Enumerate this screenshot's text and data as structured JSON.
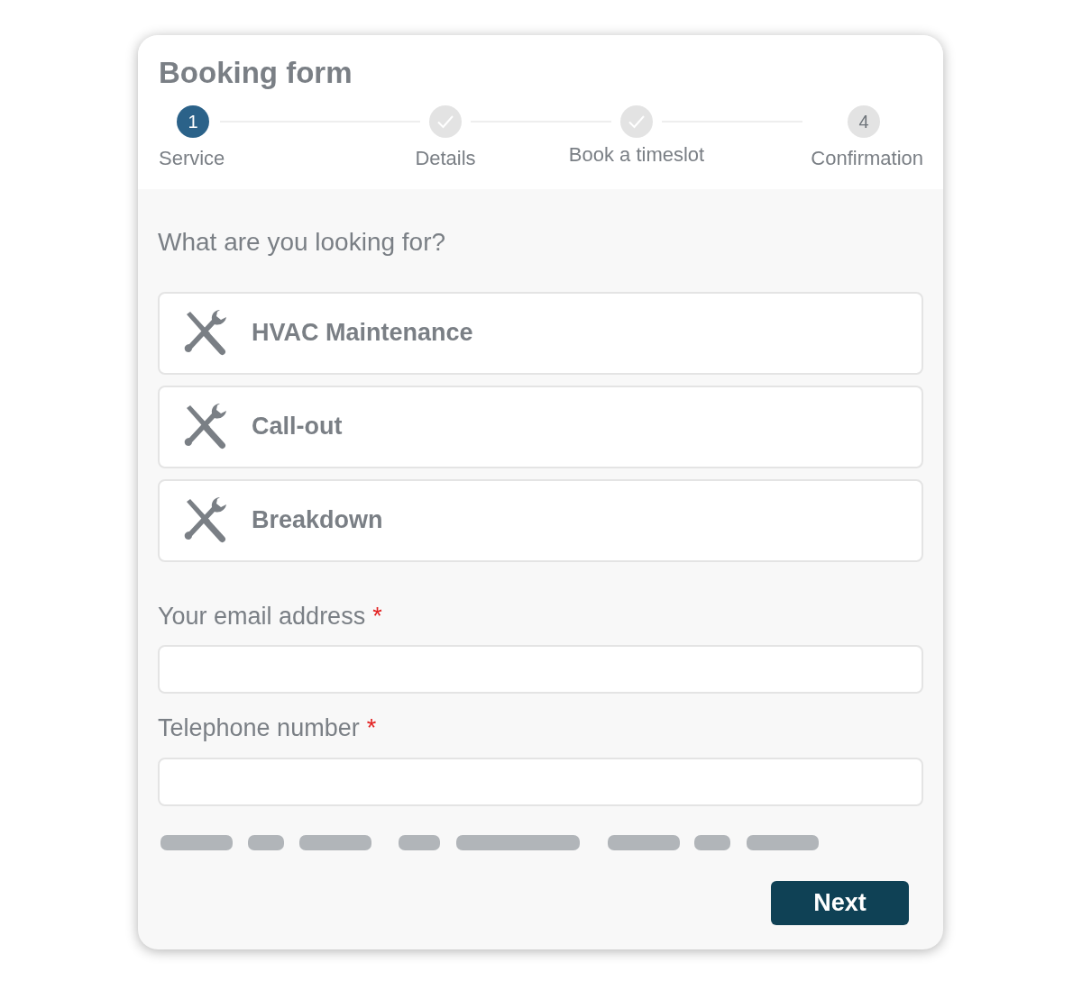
{
  "title": "Booking form",
  "steps": [
    {
      "label": "Service",
      "current": true,
      "done": false,
      "number": "1"
    },
    {
      "label": "Details",
      "current": false,
      "done": true
    },
    {
      "label": "Book a timeslot",
      "current": false,
      "done": true
    },
    {
      "label": "Confirmation",
      "current": false,
      "done": false,
      "number": "4"
    }
  ],
  "question": "What are you looking for?",
  "services": [
    {
      "label": "HVAC Maintenance"
    },
    {
      "label": "Call-out"
    },
    {
      "label": "Breakdown"
    }
  ],
  "fields": [
    {
      "label": "Your email address",
      "required": true,
      "required_mark": "*"
    },
    {
      "label": "Telephone number",
      "required": true,
      "required_mark": "*"
    }
  ],
  "next_button": "Next"
}
